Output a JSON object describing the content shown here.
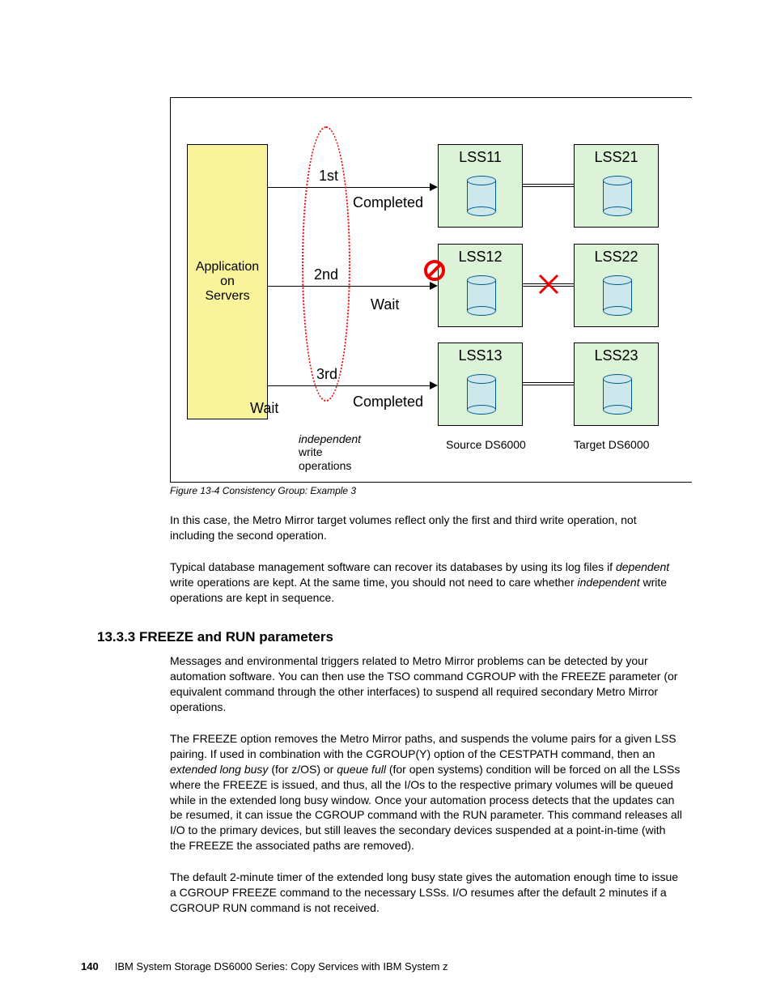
{
  "figure": {
    "app_line1": "Application",
    "app_line2": "on",
    "app_line3": "Servers",
    "lss11": "LSS11",
    "lss12": "LSS12",
    "lss13": "LSS13",
    "lss21": "LSS21",
    "lss22": "LSS22",
    "lss23": "LSS23",
    "step1": "1st",
    "step2": "2nd",
    "step3": "3rd",
    "status1": "Completed",
    "status2": "Wait",
    "status3": "Completed",
    "bottom_wait": "Wait",
    "independent": "independent",
    "write": "write",
    "operations": "operations",
    "source": "Source DS6000",
    "target": "Target DS6000"
  },
  "caption": "Figure 13-4   Consistency Group: Example 3",
  "para1": "In this case, the Metro Mirror target volumes reflect only the first and third write operation, not including the second operation.",
  "para2a": "Typical database management software can recover its databases by using its log files if ",
  "para2b_italic": "dependent",
  "para2c": " write operations are kept. At the same time, you should not need to care whether ",
  "para2d_italic": "independent",
  "para2e": " write operations are kept in sequence.",
  "heading": "13.3.3  FREEZE and RUN parameters",
  "para3": "Messages and environmental triggers related to Metro Mirror problems can be detected by your automation software. You can then use the TSO command CGROUP with the FREEZE parameter (or equivalent command through the other interfaces) to suspend all required secondary Metro Mirror operations.",
  "para4a": "The FREEZE option removes the Metro Mirror paths, and suspends the volume pairs for a given LSS pairing. If used in combination with the CGROUP(Y) option of the CESTPATH command, then an ",
  "para4b_italic": "extended long busy",
  "para4c": " (for z/OS) or ",
  "para4d_italic": "queue full",
  "para4e": " (for open systems) condition will be forced on all the LSSs where the FREEZE is issued, and thus, all the I/Os to the respective primary volumes will be queued while in the extended long busy window. Once your automation process detects that the updates can be resumed, it can issue the CGROUP command with the RUN parameter. This command releases all I/O to the primary devices, but still leaves the secondary devices suspended at a point-in-time (with the FREEZE the associated paths are removed).",
  "para5": "The default 2-minute timer of the extended long busy state gives the automation enough time to issue a CGROUP FREEZE command to the necessary LSSs. I/O resumes after the default 2 minutes if a CGROUP RUN command is not received.",
  "footer_page": "140",
  "footer_text": "IBM System Storage DS6000 Series: Copy Services with IBM System z"
}
